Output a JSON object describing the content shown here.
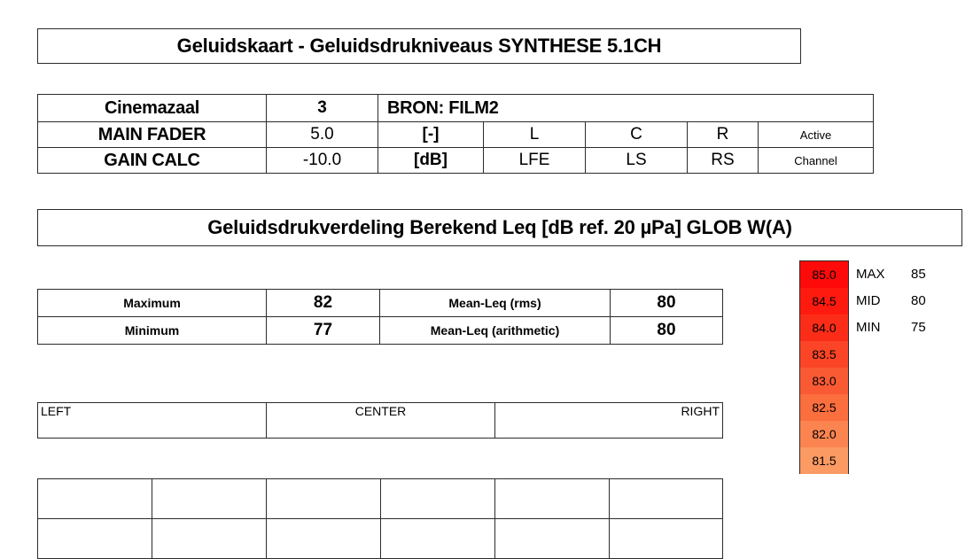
{
  "title": {
    "text": "Geluidskaart - Geluidsdrukniveaus SYNTHESE 5.1CH"
  },
  "info": {
    "hall_label": "Cinemazaal",
    "hall_value": "3",
    "source_label": "BRON:",
    "source_value": "FILM2",
    "source_combined": "BRON:   FILM2",
    "rows": [
      {
        "label": "MAIN FADER",
        "value": "5.0",
        "unit": "[-]",
        "ch1": "L",
        "ch2": "C",
        "ch3": "R",
        "tag": "Active"
      },
      {
        "label": "GAIN CALC",
        "value": "-10.0",
        "unit": "[dB]",
        "ch1": "LFE",
        "ch2": "LS",
        "ch3": "RS",
        "tag": "Channel"
      }
    ]
  },
  "section": {
    "header": "Geluidsdrukverdeling Berekend Leq [dB ref. 20 µPa] GLOB W(A)"
  },
  "stats": {
    "rows": [
      {
        "name": "Maximum",
        "value": "82",
        "name2": "Mean-Leq (rms)",
        "value2": "80"
      },
      {
        "name": "Minimum",
        "value": "77",
        "name2": "Mean-Leq (arithmetic)",
        "value2": "80"
      }
    ]
  },
  "position_band": {
    "left": "LEFT",
    "center": "CENTER",
    "right": "RIGHT"
  },
  "grid": {
    "columns": 6,
    "rows": 2,
    "cells": [
      [
        "",
        "",
        "",
        "",
        "",
        ""
      ],
      [
        "",
        "",
        "",
        "",
        "",
        ""
      ]
    ]
  },
  "scale": {
    "ticks": [
      {
        "label": "85.0",
        "color": "#FF0A0A"
      },
      {
        "label": "84.5",
        "color": "#FF1A0F"
      },
      {
        "label": "84.0",
        "color": "#FC2D18"
      },
      {
        "label": "83.5",
        "color": "#FB4526"
      },
      {
        "label": "83.0",
        "color": "#FA5A33"
      },
      {
        "label": "82.5",
        "color": "#FB6E3E"
      },
      {
        "label": "82.0",
        "color": "#FB8450"
      },
      {
        "label": "81.5",
        "color": "#FC9A63"
      }
    ]
  },
  "legend": {
    "entries": [
      {
        "key": "MAX",
        "value": "85"
      },
      {
        "key": "MID",
        "value": "80"
      },
      {
        "key": "MIN",
        "value": "75"
      }
    ]
  }
}
